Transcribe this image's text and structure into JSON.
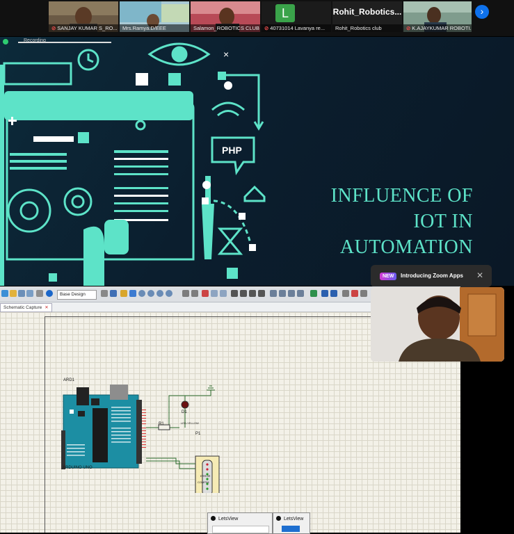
{
  "participants": [
    {
      "name": "SANJAY KUMAR S_RO...",
      "muted": true
    },
    {
      "name": "Mrs.Ramya.D/EEE",
      "muted": false
    },
    {
      "name": "Salamon_ROBOTICS CLUB",
      "muted": false
    },
    {
      "name": "40731014 Lavanya re...",
      "muted": true,
      "initial": "L"
    },
    {
      "name": "Rohit_Robotics club",
      "muted": false,
      "big_name": "Rohit_Robotics..."
    },
    {
      "name": "K.AJAYKUMAR ROBOTI...",
      "muted": true
    }
  ],
  "recording_label": "Recording",
  "slide": {
    "title_lines": [
      "INFLUENCE OF",
      "IOT IN",
      "AUTOMATION"
    ],
    "php_label": "PHP",
    "accent": "#5de3c8"
  },
  "notification": {
    "badge": "NEW",
    "text": "Introducing Zoom Apps",
    "close": "✕"
  },
  "proteus": {
    "layer_select": "Base Design",
    "tab": "Schematic Capture",
    "arduino_ref": "ARD1",
    "arduino_model": "ARDUINO UNO",
    "r1": "R1",
    "d1": "D1",
    "d1_type": "LED-YELLOW",
    "p1": "P1",
    "p1_type": "COMPIM",
    "p1_sub": "ERROR"
  },
  "letsview": [
    "LetsView",
    "LetsView"
  ]
}
